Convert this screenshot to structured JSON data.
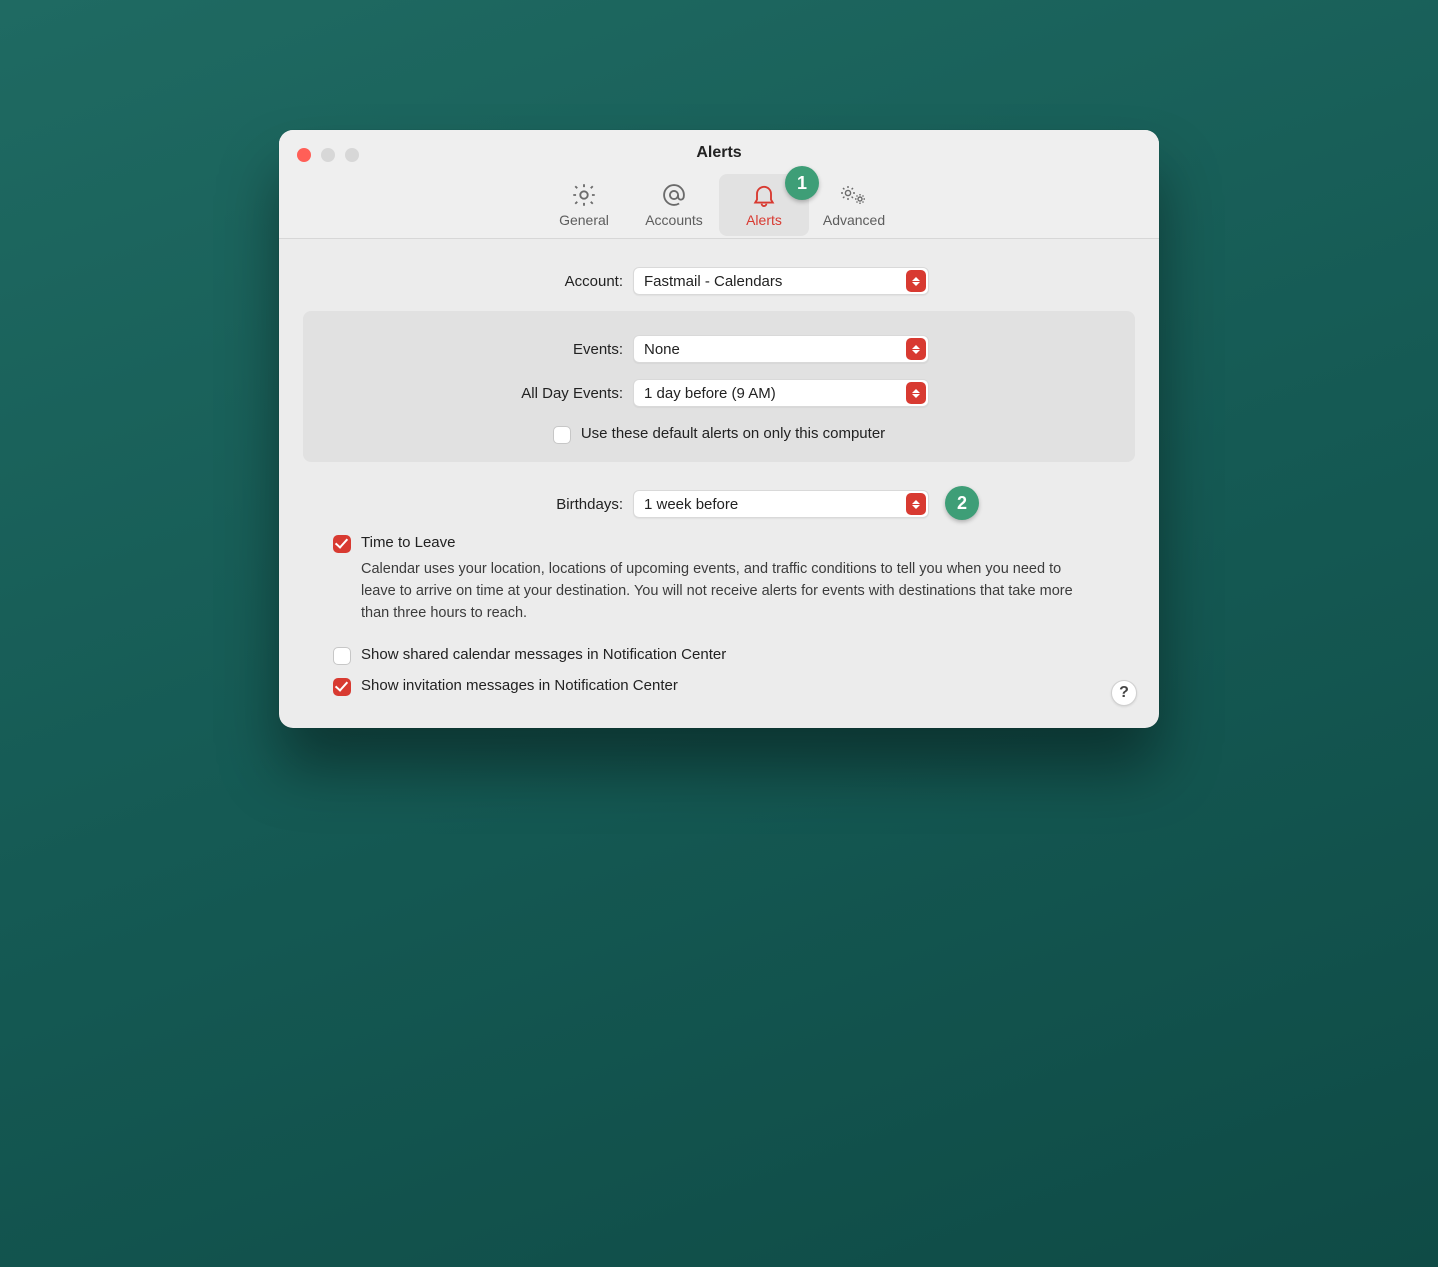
{
  "title": "Alerts",
  "tabs": {
    "general": "General",
    "accounts": "Accounts",
    "alerts": "Alerts",
    "advanced": "Advanced"
  },
  "callouts": {
    "one": "1",
    "two": "2"
  },
  "labels": {
    "account": "Account:",
    "events": "Events:",
    "all_day_events": "All Day Events:",
    "birthdays": "Birthdays:"
  },
  "values": {
    "account": "Fastmail - Calendars",
    "events": "None",
    "all_day_events": "1 day before (9 AM)",
    "birthdays": "1 week before"
  },
  "checkboxes": {
    "use_defaults_this_computer": "Use these default alerts on only this computer",
    "time_to_leave": "Time to Leave",
    "shared_calendar_nc": "Show shared calendar messages in Notification Center",
    "invitation_nc": "Show invitation messages in Notification Center"
  },
  "descriptions": {
    "time_to_leave": "Calendar uses your location, locations of upcoming events, and traffic conditions to tell you when you need to leave to arrive on time at your destination. You will not receive alerts for events with destinations that take more than three hours to reach."
  },
  "help": "?"
}
